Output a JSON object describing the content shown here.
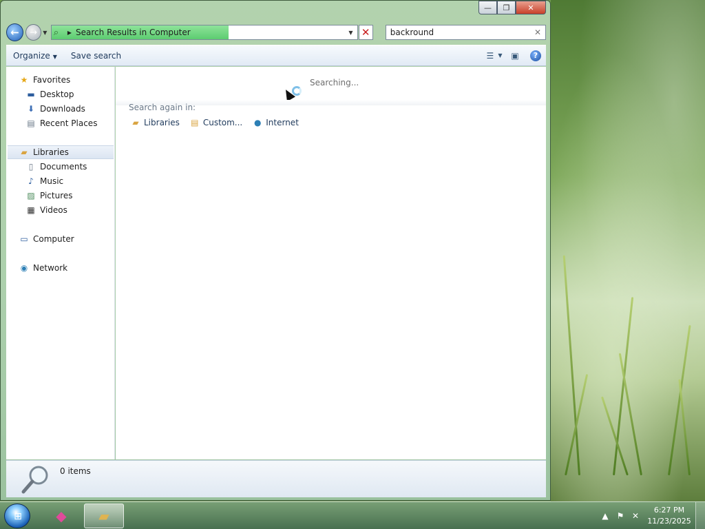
{
  "window": {
    "controls": {
      "minimize": "—",
      "maximize": "❐",
      "close": "✕"
    }
  },
  "navigation": {
    "address_text": "Search Results in Computer",
    "address_progress_fraction": 0.58,
    "search_value": "backround"
  },
  "toolbar": {
    "organize_label": "Organize",
    "save_search_label": "Save search"
  },
  "nav_pane": {
    "favorites": {
      "label": "Favorites",
      "items": [
        "Desktop",
        "Downloads",
        "Recent Places"
      ]
    },
    "libraries": {
      "label": "Libraries",
      "items": [
        "Documents",
        "Music",
        "Pictures",
        "Videos"
      ]
    },
    "computer": {
      "label": "Computer"
    },
    "network": {
      "label": "Network"
    }
  },
  "content": {
    "status": "Searching...",
    "search_again_label": "Search again in:",
    "search_again_options": [
      "Libraries",
      "Custom...",
      "Internet"
    ]
  },
  "details_pane": {
    "item_count": "0 items"
  },
  "taskbar": {
    "clock_time": "6:27 PM",
    "clock_date": "11/23/2025"
  },
  "icons": {
    "back": "back-arrow-icon",
    "forward": "forward-arrow-icon",
    "search": "magnifier-icon",
    "help": "help-icon",
    "folder": "folder-icon",
    "globe": "internet-globe-icon"
  },
  "colors": {
    "address_progress": "#5ccc70",
    "stop_red": "#c81e1e",
    "link_text": "#1e395b"
  }
}
